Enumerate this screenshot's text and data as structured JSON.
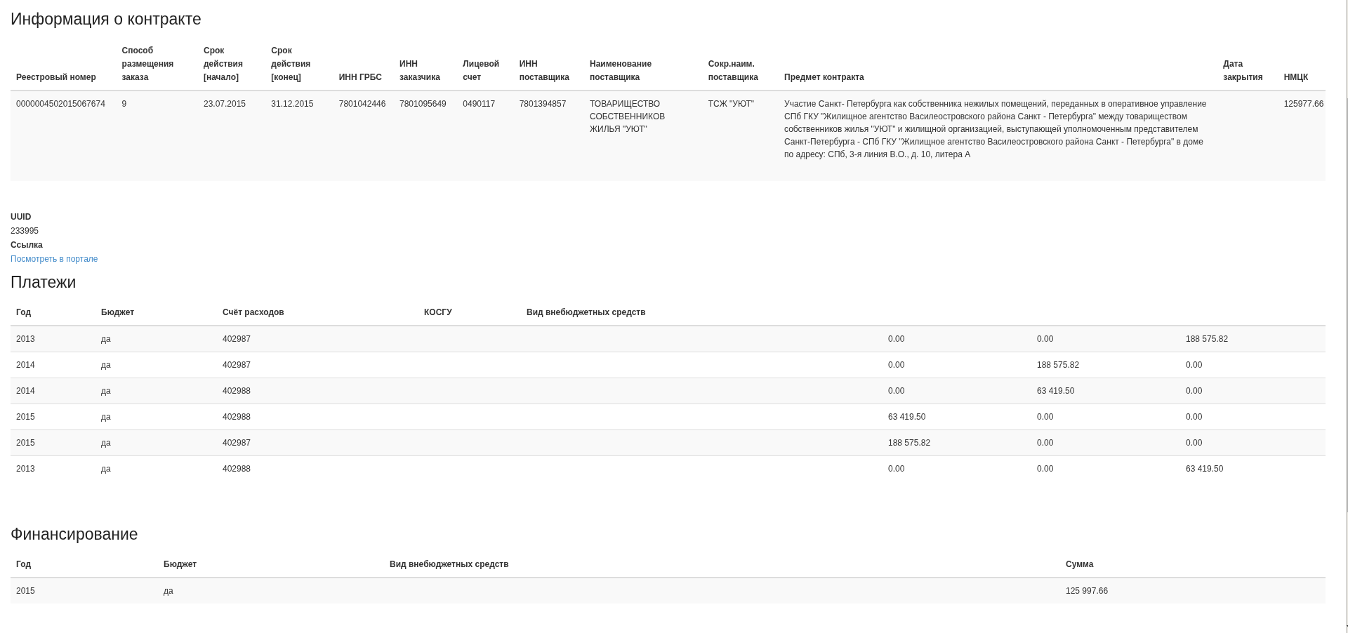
{
  "contract": {
    "title": "Информация о контракте",
    "columns": [
      "Реестровый номер",
      "Способ размещения заказа",
      "Срок действия [начало]",
      "Срок действия [конец]",
      "ИНН ГРБС",
      "ИНН заказчика",
      "Лицевой счет",
      "ИНН поставщика",
      "Наименование поставщика",
      "Сокр.наим. поставщика",
      "Предмет контракта",
      "Дата закрытия",
      "НМЦК"
    ],
    "row": {
      "registry_number": "0000004502015067674",
      "placement_method": "9",
      "start": "23.07.2015",
      "end": "31.12.2015",
      "inn_grbs": "7801042446",
      "inn_customer": "7801095649",
      "account": "0490117",
      "inn_supplier": "7801394857",
      "supplier_name": "ТОВАРИЩЕСТВО СОБСТВЕННИКОВ ЖИЛЬЯ \"УЮТ\"",
      "supplier_short": "ТСЖ \"УЮТ\"",
      "subject": "Участие Санкт- Петербурга как собственника нежилых помещений, переданных в оперативное управление СПб ГКУ \"Жилищное агентство Василеостровского района Санкт - Петербурга\" между товариществом собственников жилья \"УЮТ\" и жилищной организацией, выступающей уполномоченным представителем Санкт-Петербурга - СПб ГКУ \"Жилищное агентство Василеостровского района Санкт - Петербурга\" в доме по адресу: СПб, 3-я линия В.О., д. 10, литера А",
      "nmck": "125977.66"
    }
  },
  "details": {
    "uuid_label": "UUID",
    "uuid": "233995",
    "link_label": "Ссылка",
    "link": "Посмотреть в портале"
  },
  "payments": {
    "title": "Платежи",
    "columns": [
      "Год",
      "Бюджет",
      "Счёт расходов",
      "КОСГУ",
      "Вид внебюджетных средств"
    ],
    "rows": [
      {
        "year": "2013",
        "budget": "да",
        "account": "402987",
        "column_6": "0.00",
        "column_7": "0.00",
        "column_8": "188 575.82"
      },
      {
        "year": "2014",
        "budget": "да",
        "account": "402987",
        "column_6": "0.00",
        "column_7": "188 575.82",
        "column_8": "0.00"
      },
      {
        "year": "2014",
        "budget": "да",
        "account": "402988",
        "column_6": "0.00",
        "column_7": "63 419.50",
        "column_8": "0.00"
      },
      {
        "year": "2015",
        "budget": "да",
        "account": "402988",
        "column_6": "63 419.50",
        "column_7": "0.00",
        "column_8": "0.00"
      },
      {
        "year": "2015",
        "budget": "да",
        "account": "402987",
        "column_6": "188 575.82",
        "column_7": "0.00",
        "column_8": "0.00"
      },
      {
        "year": "2013",
        "budget": "да",
        "account": "402988",
        "column_6": "0.00",
        "column_7": "0.00",
        "column_8": "63 419.50"
      }
    ]
  },
  "financing": {
    "title": "Финансирование",
    "columns": [
      "Год",
      "Бюджет",
      "Вид внебюджетных средств",
      "Сумма"
    ],
    "rows": [
      {
        "year": "2015",
        "budget": "да",
        "sum": "125 997.66"
      }
    ]
  }
}
